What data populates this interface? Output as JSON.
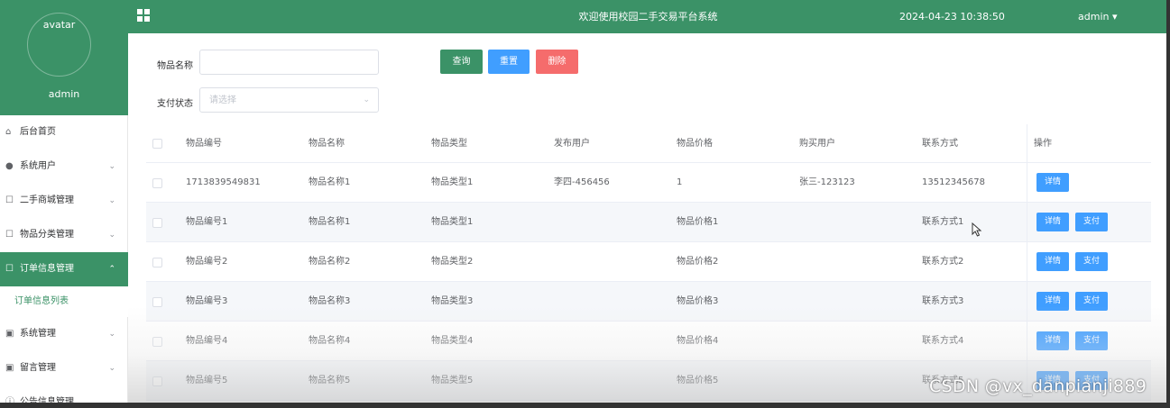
{
  "sidebar": {
    "avatar_label": "avatar",
    "username": "admin",
    "menu": [
      {
        "label": "后台首页",
        "icon": "home-icon",
        "glyph": "⌂",
        "chevron": "",
        "type": "item"
      },
      {
        "label": "系统用户",
        "icon": "user-icon",
        "glyph": "●",
        "chevron": "⌄",
        "type": "item"
      },
      {
        "label": "二手商城管理",
        "icon": "document-icon",
        "glyph": "☐",
        "chevron": "⌄",
        "type": "item"
      },
      {
        "label": "物品分类管理",
        "icon": "document-icon",
        "glyph": "☐",
        "chevron": "⌄",
        "type": "item"
      },
      {
        "label": "订单信息管理",
        "icon": "document-icon",
        "glyph": "☐",
        "chevron": "⌃",
        "type": "active"
      },
      {
        "label": "订单信息列表",
        "icon": "",
        "glyph": "",
        "chevron": "",
        "type": "sub"
      },
      {
        "label": "系统管理",
        "icon": "image-icon",
        "glyph": "▣",
        "chevron": "⌄",
        "type": "item"
      },
      {
        "label": "留言管理",
        "icon": "image-icon",
        "glyph": "▣",
        "chevron": "⌄",
        "type": "item"
      },
      {
        "label": "公告信息管理",
        "icon": "info-icon",
        "glyph": "ⓘ",
        "chevron": "⌄",
        "type": "item"
      }
    ]
  },
  "topbar": {
    "title": "欢迎使用校园二手交易平台系统",
    "datetime": "2024-04-23 10:38:50",
    "user": "admin ▾"
  },
  "search": {
    "name_label": "物品名称",
    "name_value": "",
    "pay_label": "支付状态",
    "pay_placeholder": "请选择",
    "query_button": "查询",
    "reset_button": "重置",
    "delete_button": "删除"
  },
  "colors": {
    "primary_green": "#3b9267",
    "query_button": "#3b9267",
    "reset_button": "#409eff",
    "delete_button": "#f56c6c",
    "action_button": "#409eff"
  },
  "table": {
    "headers": [
      "物品编号",
      "物品名称",
      "物品类型",
      "发布用户",
      "物品价格",
      "购买用户",
      "联系方式",
      "操作"
    ],
    "rows": [
      {
        "cells": [
          "1713839549831",
          "物品名称1",
          "物品类型1",
          "李四-456456",
          "1",
          "张三-123123",
          "13512345678"
        ],
        "actions": [
          "详情"
        ]
      },
      {
        "cells": [
          "物品编号1",
          "物品名称1",
          "物品类型1",
          "",
          "物品价格1",
          "",
          "联系方式1"
        ],
        "actions": [
          "详情",
          "支付"
        ]
      },
      {
        "cells": [
          "物品编号2",
          "物品名称2",
          "物品类型2",
          "",
          "物品价格2",
          "",
          "联系方式2"
        ],
        "actions": [
          "详情",
          "支付"
        ]
      },
      {
        "cells": [
          "物品编号3",
          "物品名称3",
          "物品类型3",
          "",
          "物品价格3",
          "",
          "联系方式3"
        ],
        "actions": [
          "详情",
          "支付"
        ]
      },
      {
        "cells": [
          "物品编号4",
          "物品名称4",
          "物品类型4",
          "",
          "物品价格4",
          "",
          "联系方式4"
        ],
        "actions": [
          "详情",
          "支付"
        ]
      },
      {
        "cells": [
          "物品编号5",
          "物品名称5",
          "物品类型5",
          "",
          "物品价格5",
          "",
          "联系方式5"
        ],
        "actions": [
          "详情",
          "支付"
        ]
      }
    ]
  },
  "watermark": "CSDN @vx_danpianji889"
}
